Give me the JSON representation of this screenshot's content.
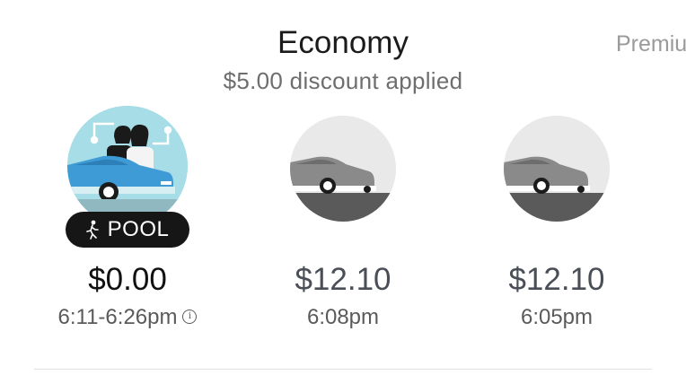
{
  "header": {
    "title": "Economy",
    "subtitle": "$5.00 discount applied",
    "next_tab": "Premiu"
  },
  "options": [
    {
      "name": "POOL",
      "price": "$0.00",
      "eta": "6:11-6:26pm",
      "selected": true,
      "icon": "walking-person-icon"
    },
    {
      "name": "",
      "price": "$12.10",
      "eta": "6:08pm",
      "selected": false
    },
    {
      "name": "",
      "price": "$12.10",
      "eta": "6:05pm",
      "selected": false
    }
  ],
  "colors": {
    "pool_bg": "#a6dde6",
    "car_blue": "#3f9bd6",
    "car_grey": "#8a8a8a",
    "badge_bg": "#161616"
  }
}
